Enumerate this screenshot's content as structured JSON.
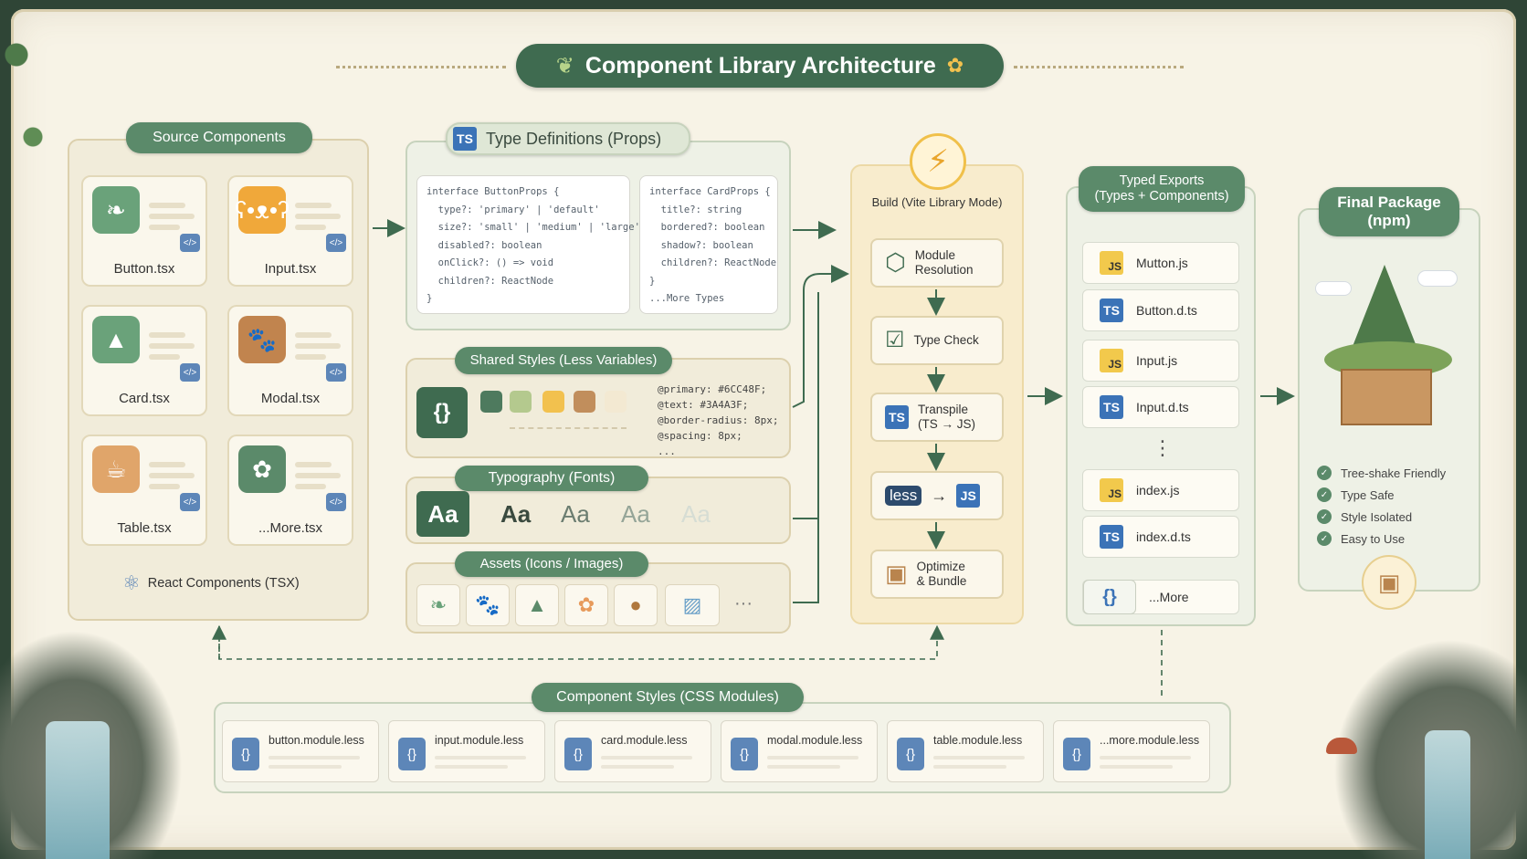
{
  "title": "Component Library Architecture",
  "source": {
    "label": "Source Components",
    "components": [
      "Button.tsx",
      "Input.tsx",
      "Card.tsx",
      "Modal.tsx",
      "Table.tsx",
      "...More.tsx"
    ],
    "footer": "React Components (TSX)"
  },
  "types": {
    "label": "Type Definitions (Props)",
    "badge": "TS",
    "button_props": [
      "interface ButtonProps {",
      "  type?: 'primary' | 'default'",
      "  size?: 'small' | 'medium' | 'large'",
      "  disabled?: boolean",
      "  onClick?: () => void",
      "  children?: ReactNode",
      "}"
    ],
    "card_props": [
      "interface CardProps {",
      "  title?: string",
      "  bordered?: boolean",
      "  shadow?: boolean",
      "  children?: ReactNode",
      "}",
      "...More Types"
    ]
  },
  "styles": {
    "label": "Shared Styles (Less Variables)",
    "brace": "{}",
    "swatch_colors": [
      "#4E7A5E",
      "#B4C98E",
      "#F2C14E",
      "#C18E5C",
      "#F3E9D2"
    ],
    "variables": [
      "@primary: #6CC48F;",
      "@text: #3A4A3F;",
      "@border-radius: 8px;",
      "@spacing: 8px;",
      "..."
    ]
  },
  "typography": {
    "label": "Typography (Fonts)",
    "samples": [
      "Aa",
      "Aa",
      "Aa",
      "Aa",
      "Aa"
    ]
  },
  "assets": {
    "label": "Assets (Icons / Images)",
    "icons": [
      "leaf-icon",
      "paw-icon",
      "tree-icon",
      "flower-icon",
      "acorn-icon",
      "landscape-icon"
    ],
    "more": "···"
  },
  "build": {
    "label": "Build (Vite Library Mode)",
    "steps": [
      {
        "line1": "Module",
        "line2": "Resolution"
      },
      {
        "line1": "Type Check",
        "line2": ""
      },
      {
        "line1": "Transpile",
        "line2": "(TS → JS)"
      },
      {
        "line1": "less",
        "line2": "JS"
      },
      {
        "line1": "Optimize",
        "line2": "& Bundle"
      }
    ]
  },
  "exports": {
    "label_line1": "Typed Exports",
    "label_line2": "(Types + Components)",
    "files": [
      {
        "badge": "JS",
        "name": "Mutton.js"
      },
      {
        "badge": "TS",
        "name": "Button.d.ts"
      },
      {
        "badge": "JS",
        "name": "Input.js"
      },
      {
        "badge": "TS",
        "name": "Input.d.ts"
      },
      {
        "badge": "JS",
        "name": "index.js"
      },
      {
        "badge": "TS",
        "name": "index.d.ts"
      }
    ],
    "ellipsis": "⋮",
    "more_badge": "{}",
    "more": "...More"
  },
  "package": {
    "label_line1": "Final Package",
    "label_line2": "(npm)",
    "features": [
      "Tree-shake Friendly",
      "Type Safe",
      "Style Isolated",
      "Easy to Use"
    ]
  },
  "css_modules": {
    "label": "Component Styles (CSS Modules)",
    "files": [
      "button.module.less",
      "input.module.less",
      "card.module.less",
      "modal.module.less",
      "table.module.less",
      "...more.module.less"
    ],
    "brace": "{}"
  },
  "colors": {
    "primary": "#3f6b50",
    "label_green": "#5b8a6a",
    "ts_blue": "#3b73b7",
    "js_yellow": "#f2c94c",
    "panel": "#f1ecda"
  }
}
